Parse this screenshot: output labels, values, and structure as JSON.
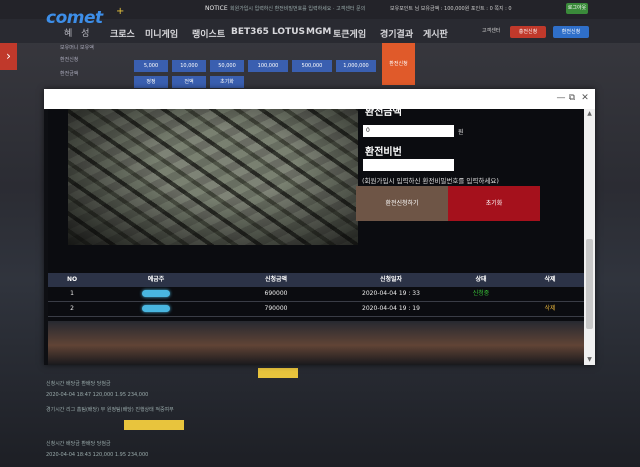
{
  "header": {
    "logo": "comet",
    "logo_plus": "+",
    "logo_sub": "혜 성",
    "notice_label": "NOTICE",
    "notice_text": "회원가입시 입력하신 환전비밀번호를 입력하세요 · 고객센터 문의",
    "user_info": "보유포인트 님  보유금액 : 100,000원   포인트 : 0   쪽지 : 0",
    "user_button": "로그아웃"
  },
  "nav": {
    "items": [
      "크로스",
      "미니게임",
      "랭이스트",
      "BET365",
      "LOTUS",
      "MGM",
      "토큰게임",
      "경기결과",
      "게시판"
    ],
    "right_text": "고객센터",
    "btn_red": "충전신청",
    "btn_blue": "환전신청"
  },
  "background": {
    "labels": [
      "보유머니 보유액",
      "환전신청",
      "환전금액"
    ],
    "chips": [
      "5,000",
      "10,000",
      "50,000",
      "100,000",
      "500,000",
      "1,000,000"
    ],
    "small_chips": [
      "정정",
      "전액",
      "초기화"
    ],
    "orange_btn": "환전신청",
    "rows": [
      "신청시간        배당금        환배당        당첨금",
      "2020-04-04 18:47     120,000      1.95       234,000",
      "경기시간    리그    홈팀(배당)    무    원정팀(배당)    진행상태    적중여부",
      "신청시간        배당금        환배당        당첨금",
      "2020-04-04 18:43     120,000      1.95       234,000"
    ]
  },
  "modal": {
    "controls": [
      "—",
      "⧉",
      "✕"
    ],
    "amount_label": "환전금액",
    "amount_value": "0",
    "amount_unit": "원",
    "password_label": "환전비번",
    "password_value": "",
    "help_text": "(회원가입시 입력하신 환전비밀번호를 입력하세요)",
    "apply_button": "환전신청하기",
    "reset_button": "초기화",
    "table": {
      "headers": [
        "NO",
        "예금주",
        "신청금액",
        "신청일자",
        "상태",
        "삭제"
      ],
      "rows": [
        {
          "no": "1",
          "amount": "690000",
          "date": "2020-04-04 19 : 33",
          "status": "신청중",
          "action": ""
        },
        {
          "no": "2",
          "amount": "790000",
          "date": "2020-04-04 19 : 19",
          "status": "",
          "action": "삭제"
        }
      ]
    }
  }
}
